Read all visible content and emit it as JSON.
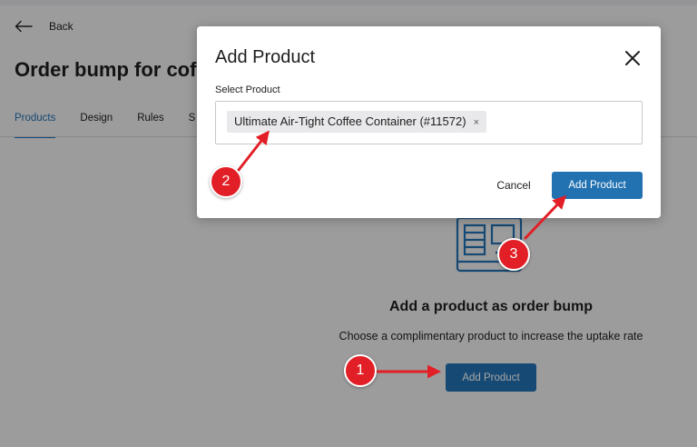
{
  "header": {
    "back_label": "Back",
    "page_title": "Order bump for cof"
  },
  "tabs": [
    {
      "label": "Products",
      "active": true
    },
    {
      "label": "Design",
      "active": false
    },
    {
      "label": "Rules",
      "active": false
    },
    {
      "label": "S",
      "active": false
    }
  ],
  "empty_state": {
    "title": "Add a product as order bump",
    "description": "Choose a complimentary product to increase the uptake rate",
    "button_label": "Add Product"
  },
  "modal": {
    "title": "Add Product",
    "select_label": "Select Product",
    "selected_product": "Ultimate Air-Tight Coffee Container (#11572)",
    "remove_glyph": "×",
    "cancel_label": "Cancel",
    "confirm_label": "Add Product"
  },
  "steps": [
    "1",
    "2",
    "3"
  ],
  "colors": {
    "primary": "#2271b1",
    "annotation": "#e21f26",
    "background": "#f0f0f1"
  }
}
